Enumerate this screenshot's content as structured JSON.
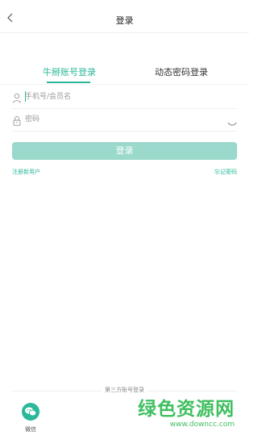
{
  "header": {
    "title": "登录"
  },
  "tabs": [
    {
      "label": "牛掰账号登录",
      "active": true
    },
    {
      "label": "动态密码登录",
      "active": false
    }
  ],
  "form": {
    "account_placeholder": "手机号/会员名",
    "password_placeholder": "密码",
    "login_label": "登录"
  },
  "links": {
    "register": "注册新用户",
    "forgot": "忘记密码"
  },
  "third_party": {
    "title": "第三方账号登录",
    "wechat_label": "微信"
  },
  "watermark": {
    "text": "绿色资源网",
    "url": "www.downcc.com"
  },
  "colors": {
    "accent": "#2bb79a",
    "button_disabled": "#9ad9cb",
    "watermark": "#3fbf5f"
  }
}
